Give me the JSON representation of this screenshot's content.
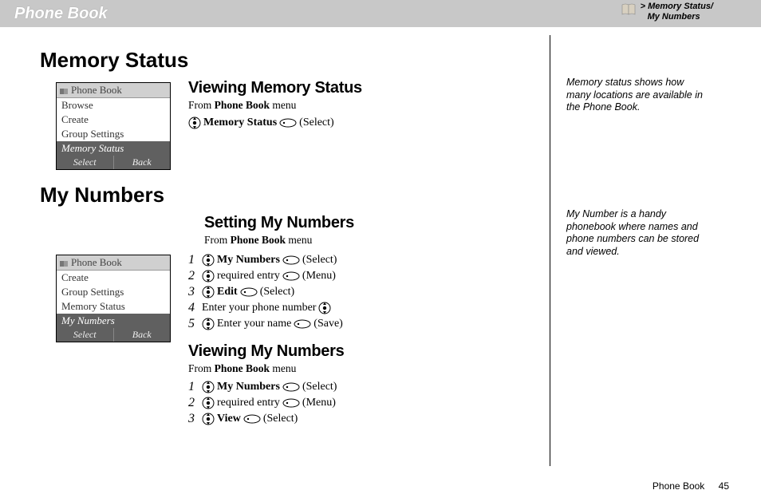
{
  "header": {
    "title": "Phone Book",
    "breadcrumb_prefix": ">",
    "breadcrumb_line1": "Memory Status/",
    "breadcrumb_line2": "My Numbers"
  },
  "sections": {
    "memory_status": {
      "heading": "Memory Status",
      "viewing": {
        "title": "Viewing Memory Status",
        "from_prefix": "From ",
        "from_bold": "Phone Book",
        "from_suffix": " menu",
        "step_bold": "Memory Status",
        "step_action": "(Select)"
      },
      "screenshot": {
        "title": "Phone Book",
        "items": [
          "Browse",
          "Create",
          "Group Settings",
          "Memory Status"
        ],
        "selected_index": 3,
        "soft_left": "Select",
        "soft_right": "Back"
      }
    },
    "my_numbers": {
      "heading": "My Numbers",
      "setting": {
        "title": "Setting My Numbers",
        "from_prefix": "From ",
        "from_bold": "Phone Book",
        "from_suffix": " menu",
        "steps": [
          {
            "n": "1",
            "bold": "My Numbers",
            "plain": "",
            "action": "(Select)"
          },
          {
            "n": "2",
            "bold": "",
            "plain": "required entry",
            "action": "(Menu)"
          },
          {
            "n": "3",
            "bold": "Edit",
            "plain": "",
            "action": "(Select)"
          },
          {
            "n": "4",
            "bold": "",
            "plain": "Enter your phone number",
            "action": "",
            "trail_nav": true
          },
          {
            "n": "5",
            "bold": "",
            "plain": "Enter your name",
            "action": "(Save)"
          }
        ]
      },
      "viewing": {
        "title": "Viewing My Numbers",
        "from_prefix": "From ",
        "from_bold": "Phone Book",
        "from_suffix": " menu",
        "steps": [
          {
            "n": "1",
            "bold": "My Numbers",
            "plain": "",
            "action": "(Select)"
          },
          {
            "n": "2",
            "bold": "",
            "plain": "required entry",
            "action": "(Menu)"
          },
          {
            "n": "3",
            "bold": "View",
            "plain": "",
            "action": "(Select)"
          }
        ]
      },
      "screenshot": {
        "title": "Phone Book",
        "items": [
          "Create",
          "Group Settings",
          "Memory Status",
          "My Numbers"
        ],
        "selected_index": 3,
        "soft_left": "Select",
        "soft_right": "Back"
      }
    }
  },
  "sidebar": {
    "note1": "Memory status shows how many locations are available in the Phone Book.",
    "note2": "My Number is a handy phonebook where names and phone numbers can be stored and viewed."
  },
  "footer": {
    "label": "Phone Book",
    "page": "45"
  }
}
